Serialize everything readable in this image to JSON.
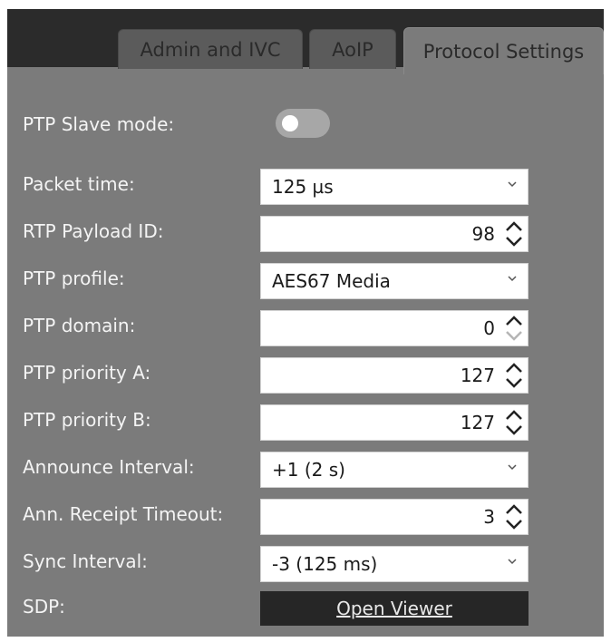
{
  "tabs": [
    {
      "label": "Admin and IVC",
      "active": false
    },
    {
      "label": "AoIP",
      "active": false
    },
    {
      "label": "Protocol Settings",
      "active": true
    }
  ],
  "settings": {
    "ptp_slave_mode": {
      "label": "PTP Slave mode:",
      "enabled": false
    },
    "packet_time": {
      "label": "Packet time:",
      "value": "125 µs"
    },
    "rtp_payload_id": {
      "label": "RTP Payload ID:",
      "value": "98"
    },
    "ptp_profile": {
      "label": "PTP profile:",
      "value": "AES67 Media"
    },
    "ptp_domain": {
      "label": "PTP domain:",
      "value": "0"
    },
    "ptp_priority_a": {
      "label": "PTP priority A:",
      "value": "127"
    },
    "ptp_priority_b": {
      "label": "PTP priority B:",
      "value": "127"
    },
    "announce_interval": {
      "label": "Announce Interval:",
      "value": "+1 (2 s)"
    },
    "ann_receipt_timeout": {
      "label": "Ann. Receipt Timeout:",
      "value": "3"
    },
    "sync_interval": {
      "label": "Sync Interval:",
      "value": "-3 (125 ms)"
    },
    "sdp": {
      "label": "SDP:",
      "button_label": "Open Viewer"
    }
  },
  "colors": {
    "panel": "#7b7b7b",
    "tabbar": "#2b2b2b",
    "label_text": "#f4f4f4",
    "button_bg": "#262626"
  },
  "icons": {
    "dropdown": "chevron-down-icon",
    "spinner_up": "chevron-up-icon",
    "spinner_down": "chevron-down-icon"
  }
}
